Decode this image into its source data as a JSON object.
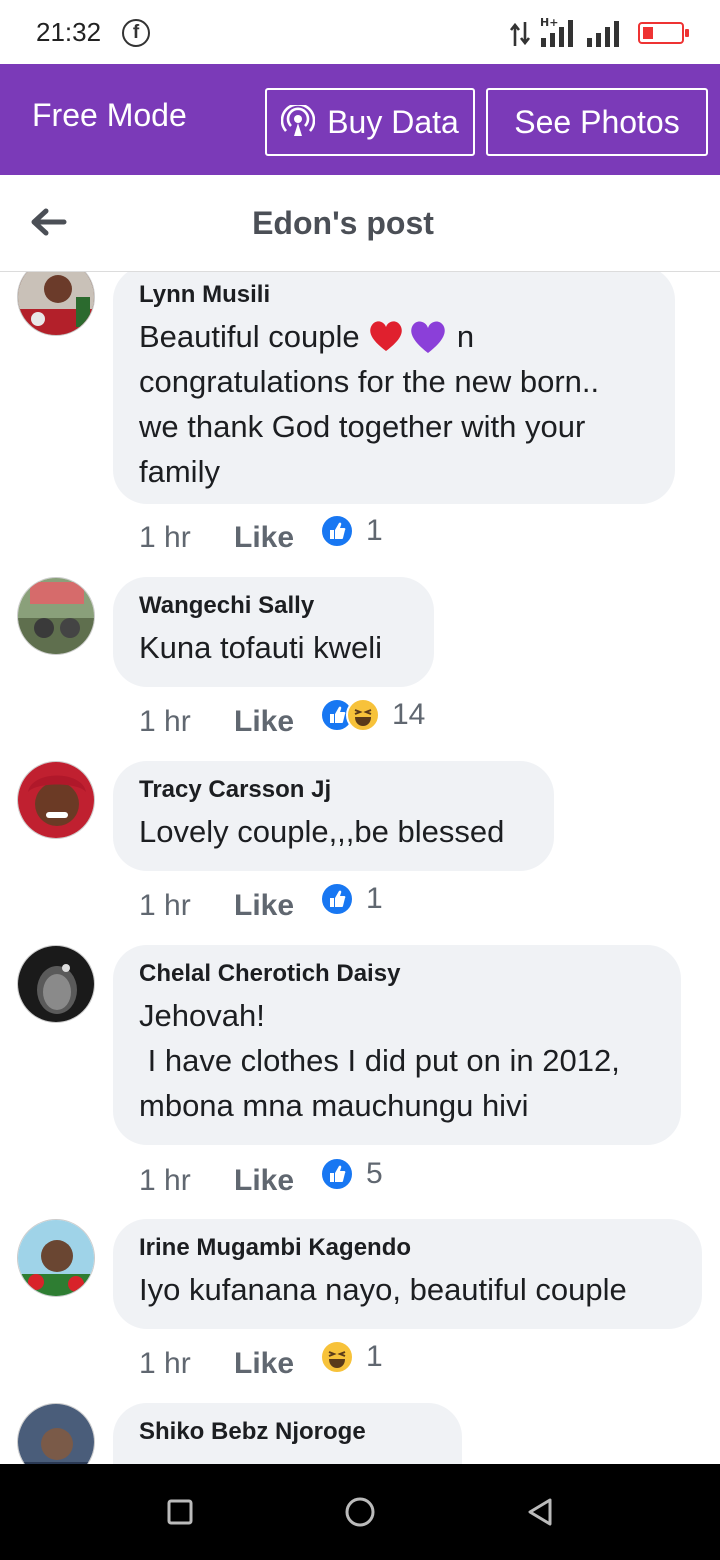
{
  "status_bar": {
    "time": "21:32",
    "app_notification_icon": "facebook-icon",
    "network": "H+",
    "battery": "low"
  },
  "mode_bar": {
    "label": "Free Mode",
    "buy_data_label": "Buy Data",
    "see_photos_label": "See Photos"
  },
  "post_header": {
    "title": "Edon's post"
  },
  "comments": [
    {
      "name": "Lynn Musili",
      "text_before": "Beautiful couple ",
      "emojis": "heart-red,heart-purple",
      "text_after": " n\ncongratulations for the new born..\nwe thank God together with your\nfamily",
      "time": "1 hr",
      "like_label": "Like",
      "reactions": [
        "like"
      ],
      "count": "1"
    },
    {
      "name": "Wangechi Sally",
      "text": "Kuna tofauti kweli",
      "time": "1 hr",
      "like_label": "Like",
      "reactions": [
        "like",
        "haha"
      ],
      "count": "14"
    },
    {
      "name": "Tracy Carsson Jj",
      "text": "Lovely couple,,,be blessed",
      "time": "1 hr",
      "like_label": "Like",
      "reactions": [
        "like"
      ],
      "count": "1"
    },
    {
      "name": "Chelal Cherotich Daisy",
      "text": "Jehovah!\n I have clothes I did put on in 2012,\nmbona mna mauchungu hivi",
      "time": "1 hr",
      "like_label": "Like",
      "reactions": [
        "like"
      ],
      "count": "5"
    },
    {
      "name": "Irine Mugambi Kagendo",
      "text": "Iyo kufanana nayo, beautiful couple",
      "time": "1 hr",
      "like_label": "Like",
      "reactions": [
        "haha"
      ],
      "count": "1"
    },
    {
      "name": "Shiko Bebz Njoroge",
      "text": "",
      "time": "",
      "like_label": "",
      "reactions": [],
      "count": ""
    }
  ],
  "colors": {
    "brand_purple": "#7b3ab8",
    "like_blue": "#1877f2",
    "bubble_gray": "#f0f2f5"
  }
}
